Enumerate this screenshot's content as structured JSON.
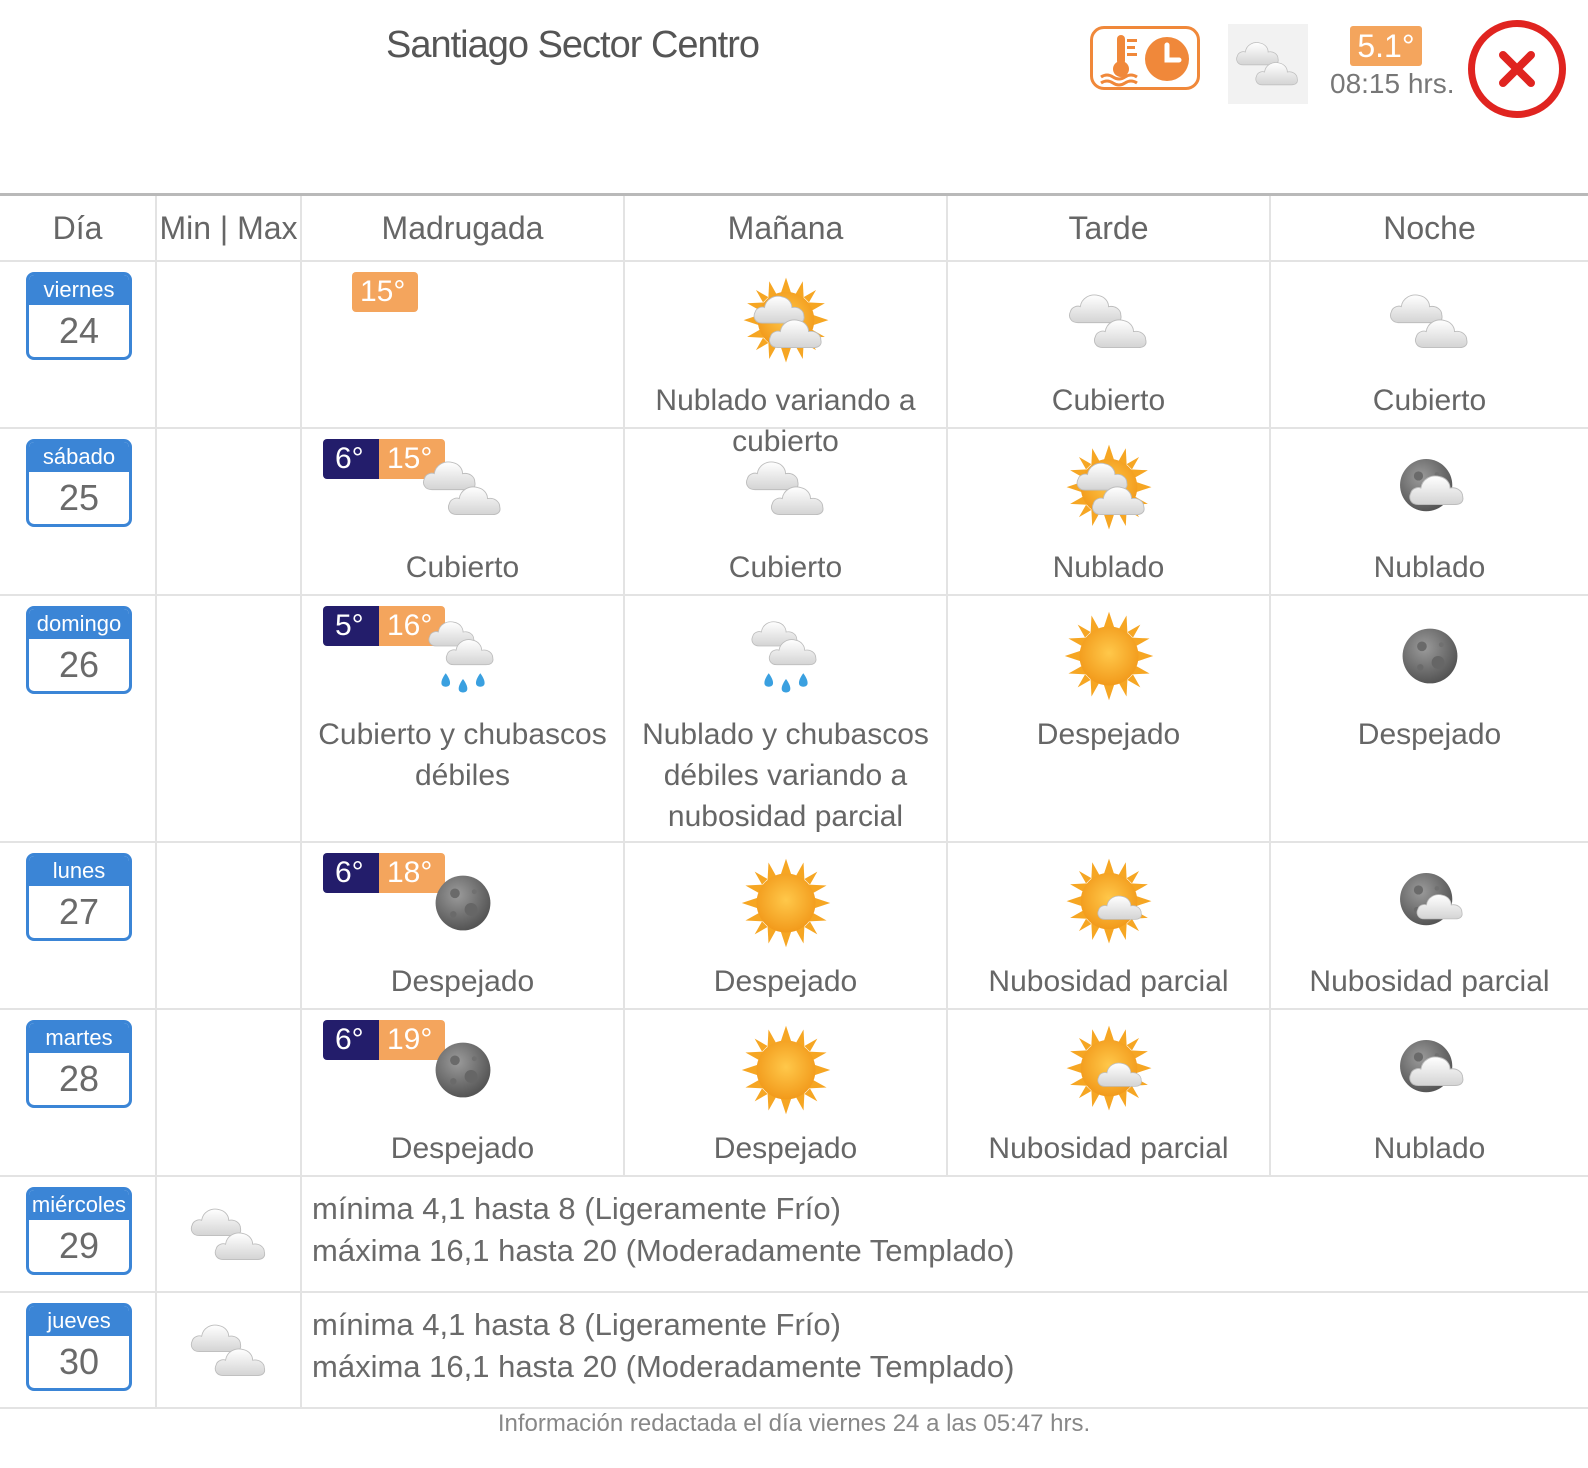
{
  "header": {
    "title": "Santiago Sector Centro",
    "current_temp": "5.1°",
    "current_time": "08:15 hrs."
  },
  "columns": [
    "Día",
    "Min | Max",
    "Madrugada",
    "Mañana",
    "Tarde",
    "Noche"
  ],
  "days": [
    {
      "name": "viernes",
      "num": "24",
      "min": "",
      "max": "15°",
      "periods": [
        {
          "icon": "",
          "desc": ""
        },
        {
          "icon": "sun-cloud",
          "desc": "Nublado variando a cubierto"
        },
        {
          "icon": "clouds",
          "desc": "Cubierto"
        },
        {
          "icon": "clouds",
          "desc": "Cubierto"
        }
      ]
    },
    {
      "name": "sábado",
      "num": "25",
      "min": "6°",
      "max": "15°",
      "periods": [
        {
          "icon": "clouds",
          "desc": "Cubierto"
        },
        {
          "icon": "clouds",
          "desc": "Cubierto"
        },
        {
          "icon": "sun-cloud",
          "desc": "Nublado"
        },
        {
          "icon": "moon-cloud",
          "desc": "Nublado"
        }
      ]
    },
    {
      "name": "domingo",
      "num": "26",
      "min": "5°",
      "max": "16°",
      "periods": [
        {
          "icon": "rain",
          "desc": "Cubierto y chubascos débiles"
        },
        {
          "icon": "rain",
          "desc": "Nublado y chubascos débiles variando a nubosidad parcial"
        },
        {
          "icon": "sun",
          "desc": "Despejado"
        },
        {
          "icon": "moon",
          "desc": "Despejado"
        }
      ]
    },
    {
      "name": "lunes",
      "num": "27",
      "min": "6°",
      "max": "18°",
      "periods": [
        {
          "icon": "moon",
          "desc": "Despejado"
        },
        {
          "icon": "sun",
          "desc": "Despejado"
        },
        {
          "icon": "sun-small-cloud",
          "desc": "Nubosidad parcial"
        },
        {
          "icon": "moon-small-cloud",
          "desc": "Nubosidad parcial"
        }
      ]
    },
    {
      "name": "martes",
      "num": "28",
      "min": "6°",
      "max": "19°",
      "periods": [
        {
          "icon": "moon",
          "desc": "Despejado"
        },
        {
          "icon": "sun",
          "desc": "Despejado"
        },
        {
          "icon": "sun-small-cloud",
          "desc": "Nubosidad parcial"
        },
        {
          "icon": "moon-cloud",
          "desc": "Nublado"
        }
      ]
    }
  ],
  "extended": [
    {
      "name": "miércoles",
      "num": "29",
      "line1": "mínima 4,1 hasta 8 (Ligeramente Frío)",
      "line2": "máxima 16,1 hasta 20 (Moderadamente Templado)"
    },
    {
      "name": "jueves",
      "num": "30",
      "line1": "mínima 4,1 hasta 8 (Ligeramente Frío)",
      "line2": "máxima 16,1 hasta 20 (Moderadamente Templado)"
    }
  ],
  "footer": "Información redactada el día viernes 24 a las 05:47 hrs.",
  "colors": {
    "accent_orange": "#f4a55d",
    "min_blue": "#231d6b",
    "day_blue": "#3b85d6",
    "close_red": "#e02420"
  }
}
